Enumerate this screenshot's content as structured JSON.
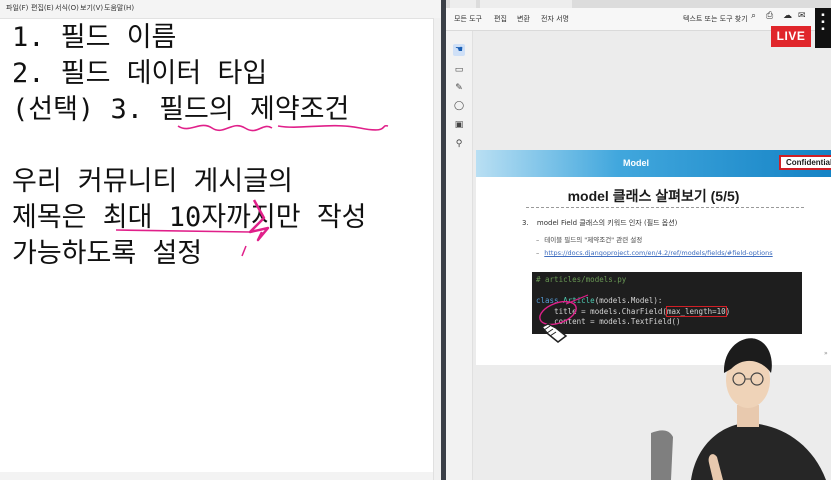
{
  "notepad": {
    "menu": [
      "파일(F)",
      "편집(E)",
      "서식(O)",
      "보기(V)",
      "도움말(H)"
    ],
    "lines": [
      "1. 필드 이름",
      "2. 필드 데이터 타입",
      "(선택) 3. 필드의 제약조건",
      "",
      "우리 커뮤니티 게시글의",
      "제목은 최대 10자까지만 작성",
      "가능하도록 설정"
    ]
  },
  "viewer": {
    "toolbar": [
      "모든 도구",
      "편집",
      "변환",
      "전자 서명"
    ],
    "search_label": "텍스트 또는 도구 찾기",
    "live_badge": "LIVE",
    "slide": {
      "header_title": "Model",
      "confidential": "Confidential",
      "title": "model 클래스 살펴보기 (5/5)",
      "item_number": "3.",
      "item": "model Field 클래스의 키워드 인자 (필드 옵션)",
      "bullet_1": "테이블 필드의 \"제약조건\" 관련 설정",
      "bullet_2": "https://docs.djangoproject.com/en/4.2/ref/models/fields/#field-options",
      "code": {
        "comment": "# articles/models.py",
        "class_kw": "class",
        "class_name": "Article",
        "class_rest": "(models.Model):",
        "title_field": "title",
        "title_assign": " = models.CharField(",
        "title_option": "max_length=10",
        "title_close": ")",
        "content_field": "content",
        "content_rest": " = models.TextField()"
      }
    }
  },
  "colors": {
    "live": "#e0262b",
    "ink": "#e0208a",
    "header": "#1583c5"
  }
}
